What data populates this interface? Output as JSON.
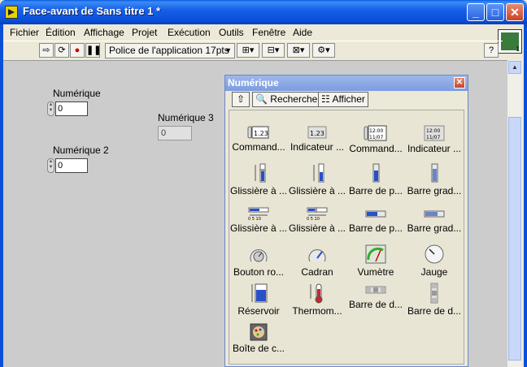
{
  "window": {
    "title": "Face-avant de Sans titre 1 *"
  },
  "menu": [
    "Fichier",
    "Édition",
    "Affichage",
    "Projet",
    "Exécution",
    "Outils",
    "Fenêtre",
    "Aide"
  ],
  "toolbar": {
    "font": "Police de l'application 17pts"
  },
  "controls": [
    {
      "label": "Numérique",
      "value": "0"
    },
    {
      "label": "Numérique 2",
      "value": "0"
    },
    {
      "label": "Numérique 3",
      "value": "0"
    }
  ],
  "palette": {
    "title": "Numérique",
    "search_label": "Rechercher",
    "show_label": "Afficher",
    "items": [
      "Command...",
      "Indicateur ...",
      "Command...",
      "Indicateur ...",
      "Glissière à ...",
      "Glissière à ...",
      "Barre de p...",
      "Barre grad...",
      "Glissière à ...",
      "Glissière à ...",
      "Barre de p...",
      "Barre grad...",
      "Bouton ro...",
      "Cadran",
      "Vumètre",
      "Jauge",
      "Réservoir",
      "Thermom...",
      "Barre de d...",
      "Barre de d...",
      "Boîte de c..."
    ]
  }
}
